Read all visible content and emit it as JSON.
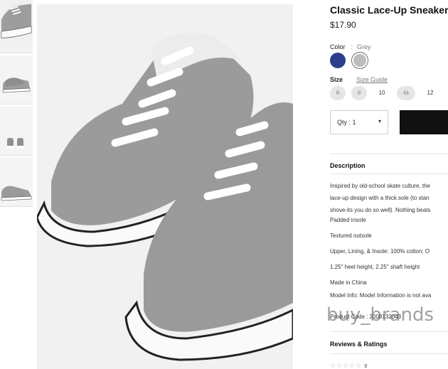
{
  "product": {
    "title": "Classic Lace-Up Sneaker",
    "price": "$17.90"
  },
  "color": {
    "label": "Color",
    "separator": ":",
    "selected": "Grey",
    "swatches": [
      {
        "name": "Navy",
        "hex": "#2c3f8c"
      },
      {
        "name": "Grey",
        "hex": "#bdbdbd"
      }
    ]
  },
  "size": {
    "label": "Size",
    "guide_link": "Size Guide",
    "options": [
      {
        "label": "8",
        "available": false
      },
      {
        "label": "9",
        "available": false
      },
      {
        "label": "10",
        "available": true
      },
      {
        "label": "11",
        "available": false
      },
      {
        "label": "12",
        "available": true
      }
    ]
  },
  "quantity": {
    "label": "Qty : 1",
    "caret": "▾"
  },
  "description": {
    "heading": "Description",
    "lines": [
      "Inspired by old-school skate culture, the",
      "lace-up design with a thick sole (to stan",
      "shove-its you do so well). Nothing beats"
    ],
    "details": [
      "Padded insole",
      "Textured outsole",
      "Upper, Lining, & Insole: 100% cotton; O",
      "1.25\" heel height, 2.25\" shaft height",
      "Made in China",
      "Model Info: Model Information is not ava",
      "Product Code : 2000132043"
    ]
  },
  "reviews": {
    "heading": "Reviews & Ratings",
    "stars": "☆☆☆☆☆",
    "count": "0"
  },
  "watermark": "buy_brands",
  "colors": {
    "accent_black": "#111111",
    "page_bg": "#ffffff",
    "shoe_grey": "#9a9a9a"
  }
}
